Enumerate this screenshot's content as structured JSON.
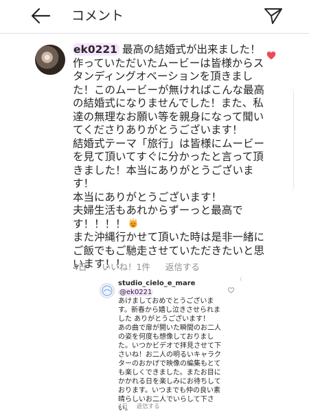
{
  "header": {
    "title": "コメント"
  },
  "comment": {
    "username": "ek0221",
    "lines": [
      "最高の結婚式が出来ました！",
      "作っていただいたムービーは皆様からス",
      "タンディングオベーションを頂きまし",
      "た！このムービーが無ければこんな最高",
      "の結婚式になりませんでした！また、私",
      "達の無理なお願い等を親身になって聞い",
      "てくださりありがとうございます！",
      "結婚式テーマ「旅行」は皆様にムービー",
      "を見て頂いてすぐに分かったと言って頂",
      "きました！本当にありがとうございま",
      "す！",
      "本当にありがとうございます！",
      "夫婦生活もあれからずーっと最高で",
      "す！！！！",
      "また沖縄行かせて頂いた時は是非一緒に",
      "ご飯でもご馳走させていただきたいと思",
      "います！！"
    ],
    "meta": {
      "time": "4日",
      "likes": "いいね！1件",
      "reply": "返信する"
    }
  },
  "reply": {
    "username": "studio_cielo_e_mare",
    "mention": "@ek0221",
    "lines": [
      "あけましておめでとうございま",
      "す。新春から嬉し泣きさせられま",
      "した ありがとうございます！",
      "あの曲で扉が開いた瞬間のお二人",
      "の姿を何度も想像しておりまし",
      "た。いつかビデオで拝見させて下",
      "さいね！お二人の明るいキャラク",
      "ターのおかげで映像の編集もとて",
      "も楽しくできました。またお目に",
      "かかれる日を楽しみにお待ちして",
      "おります。いつまでも仲の良い素",
      "晴らしいお二人でいらして下さ",
      "い。"
    ],
    "meta": {
      "time": "4日",
      "reply": "返信する"
    }
  },
  "colors": {
    "heart": "#ed4956",
    "muted": "#8e8e8e",
    "text": "#262626"
  }
}
